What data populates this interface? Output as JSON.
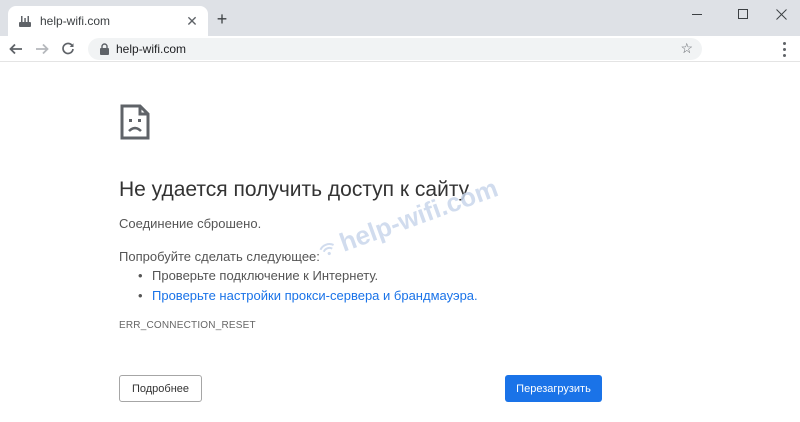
{
  "browser": {
    "tab_title": "help-wifi.com",
    "url": "help-wifi.com",
    "icons": {
      "favicon": "router-icon",
      "close": "close-icon",
      "new_tab": "plus-icon",
      "back": "arrow-left-icon",
      "forward": "arrow-right-icon",
      "reload": "reload-icon",
      "lock": "lock-icon",
      "bookmark": "star-icon",
      "menu": "kebab-menu-icon"
    }
  },
  "error": {
    "icon": "sad-page-icon",
    "heading": "Не удается получить доступ к сайту",
    "description": "Соединение сброшено.",
    "suggest_title": "Попробуйте сделать следующее:",
    "suggestions": [
      {
        "text": "Проверьте подключение к Интернету."
      },
      {
        "text": "Проверьте настройки прокси-сервера и брандмауэра."
      }
    ],
    "code": "ERR_CONNECTION_RESET",
    "details_label": "Подробнее",
    "reload_label": "Перезагрузить"
  },
  "watermark": {
    "text": "help-wifi.com"
  },
  "colors": {
    "chrome_bg": "#dee1e6",
    "link": "#1a73e8",
    "primary_button": "#1a73e8"
  }
}
